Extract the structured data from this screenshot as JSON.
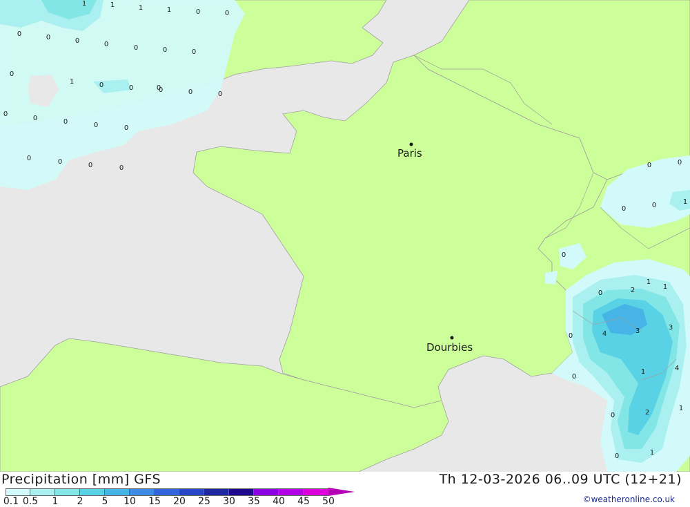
{
  "title": "Precipitation [mm] GFS",
  "datetime": "Th 12-03-2026 06..09 UTC (12+21)",
  "credit": "©weatheronline.co.uk",
  "colors": {
    "land": "#ccff99",
    "sea": "#e8e8e8",
    "border": "#a0a0a0"
  },
  "legend": {
    "labels": [
      "0.1",
      "0.5",
      "1",
      "2",
      "5",
      "10",
      "15",
      "20",
      "25",
      "30",
      "35",
      "40",
      "45",
      "50"
    ],
    "colors": [
      "#d2fafa",
      "#aaf0f0",
      "#82e6e6",
      "#5ad2e6",
      "#46b4e6",
      "#3c8ce6",
      "#3264dc",
      "#2846c8",
      "#1e28a0",
      "#1e0a8c",
      "#8c00e6",
      "#b400e6",
      "#dc00dc",
      "#b400b4"
    ]
  },
  "cities": [
    {
      "name": "Paris"
    },
    {
      "name": "Dourbies"
    }
  ],
  "values": [
    "1",
    "1",
    "1",
    "1",
    "0",
    "0",
    "0",
    "0",
    "0",
    "0",
    "0",
    "0",
    "0",
    "0",
    "1",
    "0",
    "0",
    "0",
    "0",
    "0",
    "0",
    "0",
    "0",
    "0",
    "0",
    "0",
    "0",
    "0",
    "0",
    "0",
    "0",
    "0",
    "1",
    "0",
    "0",
    "1",
    "0",
    "0",
    "2",
    "1",
    "0",
    "4",
    "3",
    "3",
    "0",
    "4",
    "1",
    "0",
    "2",
    "1",
    "0",
    "1"
  ]
}
